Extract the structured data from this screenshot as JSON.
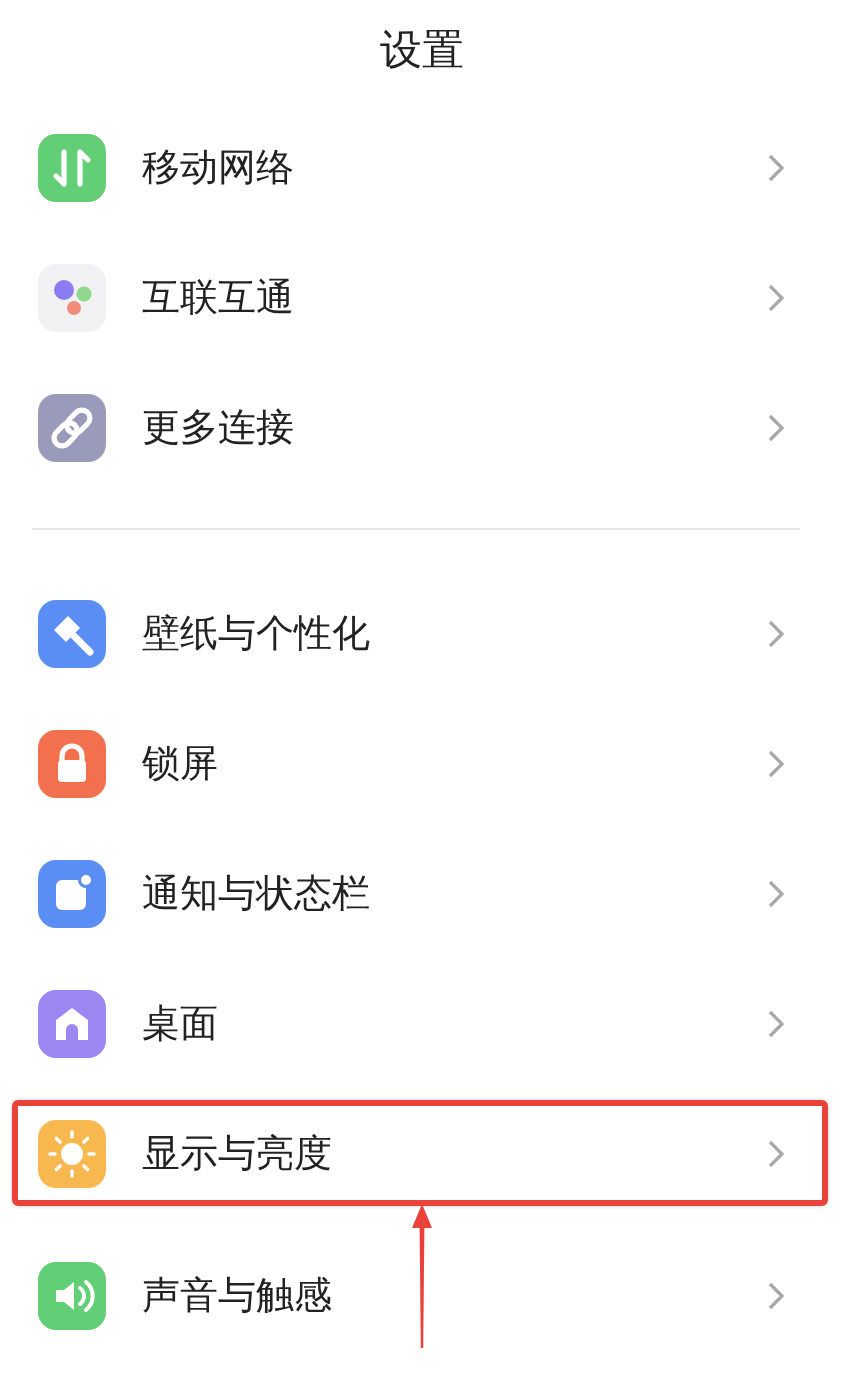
{
  "title": "设置",
  "groups": [
    {
      "items": [
        {
          "label": "移动网络",
          "highlighted": false
        },
        {
          "label": "互联互通",
          "highlighted": false
        },
        {
          "label": "更多连接",
          "highlighted": false
        }
      ]
    },
    {
      "items": [
        {
          "label": "壁纸与个性化",
          "highlighted": false
        },
        {
          "label": "锁屏",
          "highlighted": false
        },
        {
          "label": "通知与状态栏",
          "highlighted": false
        },
        {
          "label": "桌面",
          "highlighted": false
        },
        {
          "label": "显示与亮度",
          "highlighted": true
        },
        {
          "label": "声音与触感",
          "highlighted": false
        }
      ]
    }
  ]
}
